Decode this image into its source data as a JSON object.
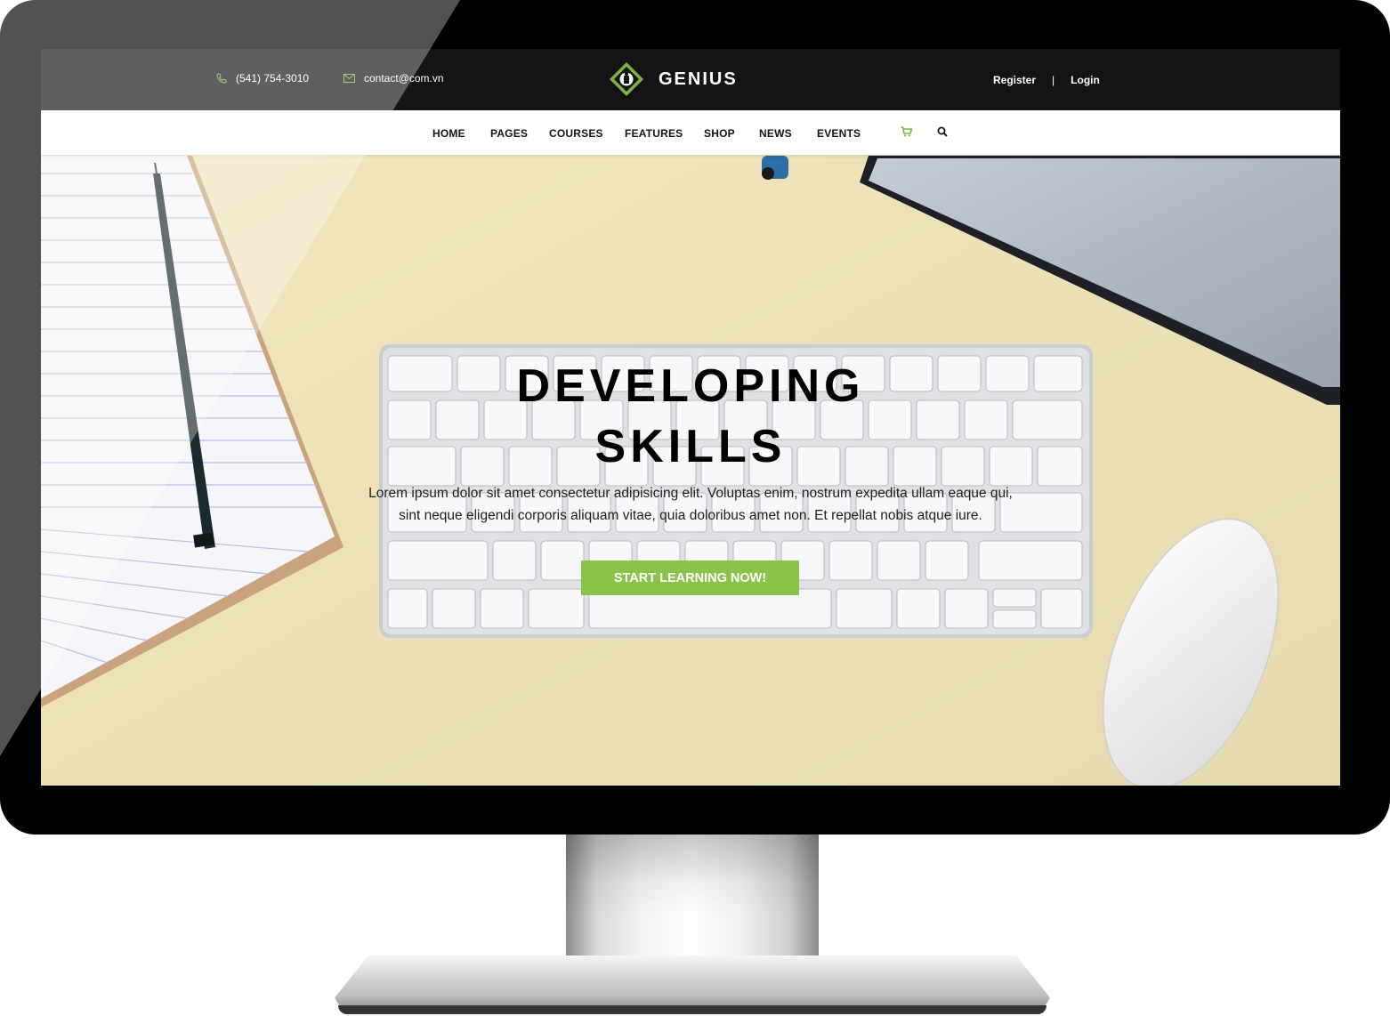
{
  "topbar": {
    "phone": "(541) 754-3010",
    "email": "contact@com.vn",
    "logo_text": "GENIUS",
    "register": "Register",
    "separator": "|",
    "login": "Login"
  },
  "nav": {
    "items": [
      "HOME",
      "PAGES",
      "COURSES",
      "FEATURES",
      "SHOP",
      "NEWS",
      "EVENTS"
    ],
    "icons": [
      "cart-icon",
      "search-icon"
    ]
  },
  "hero": {
    "title_line1": "DEVELOPING",
    "title_line2": "SKILLS",
    "description_line1": "Lorem ipsum dolor sit amet consectetur adipisicing elit. Voluptas enim, nostrum expedita ullam eaque qui,",
    "description_line2": "sint neque eligendi corporis aliquam vitae, quia doloribus amet non. Et repellat nobis atque iure.",
    "cta_label": "START LEARNING NOW!"
  },
  "colors": {
    "accent": "#8bc34a",
    "topbar_bg": "#141414",
    "nav_bg": "#ffffff",
    "desk": "#ebe0b3"
  }
}
